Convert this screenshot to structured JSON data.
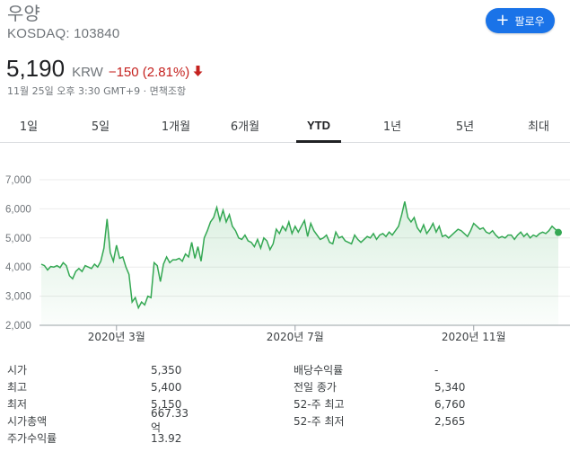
{
  "header": {
    "company": "우양",
    "ticker": "KOSDAQ: 103840",
    "follow_label": "팔로우"
  },
  "quote": {
    "price": "5,190",
    "currency": "KRW",
    "change": "−150 (2.81%)",
    "timestamp": "11월 25일 오후 3:30 GMT+9 · 면책조항"
  },
  "tabs": [
    {
      "label": "1일"
    },
    {
      "label": "5일"
    },
    {
      "label": "1개월"
    },
    {
      "label": "6개월"
    },
    {
      "label": "YTD",
      "active": true
    },
    {
      "label": "1년"
    },
    {
      "label": "5년"
    },
    {
      "label": "최대"
    }
  ],
  "colors": {
    "line": "#34a853",
    "accent": "#1a73e8",
    "negative": "#c5221f"
  },
  "chart_data": {
    "type": "area",
    "ylim": [
      2000,
      7000
    ],
    "yticks": [
      "7,000",
      "6,000",
      "5,000",
      "4,000",
      "3,000",
      "2,000"
    ],
    "ytick_values": [
      7000,
      6000,
      5000,
      4000,
      3000,
      2000
    ],
    "xtick_labels": [
      "2020년 3월",
      "2020년 7월",
      "2020년 11월"
    ],
    "xtick_index": [
      24,
      81,
      138
    ],
    "values": [
      4100,
      4050,
      3900,
      4020,
      4000,
      4050,
      3980,
      4150,
      4050,
      3700,
      3600,
      3850,
      3950,
      3850,
      4050,
      4000,
      3950,
      4100,
      4000,
      4200,
      4650,
      5650,
      4500,
      4200,
      4750,
      4300,
      4350,
      4000,
      3750,
      2800,
      2950,
      2600,
      2800,
      2700,
      3000,
      2950,
      4150,
      4050,
      3500,
      4100,
      4350,
      4150,
      4250,
      4250,
      4300,
      4200,
      4450,
      4350,
      4850,
      4300,
      4700,
      4200,
      5000,
      5250,
      5550,
      5700,
      6050,
      5600,
      5950,
      5550,
      5800,
      5400,
      5250,
      5000,
      4950,
      5100,
      4900,
      4850,
      4700,
      4950,
      4650,
      5000,
      4900,
      4600,
      4800,
      5300,
      5150,
      5400,
      5250,
      5550,
      5150,
      5400,
      5200,
      5400,
      5600,
      5050,
      5500,
      5250,
      5100,
      4950,
      5000,
      5100,
      4850,
      4800,
      5200,
      5000,
      5050,
      4900,
      4850,
      4800,
      5100,
      4950,
      4850,
      4950,
      5050,
      5000,
      5150,
      4950,
      5100,
      5150,
      5050,
      5200,
      5100,
      5250,
      5400,
      5800,
      6250,
      5700,
      5550,
      5700,
      5350,
      5200,
      5450,
      5150,
      5300,
      5500,
      5200,
      5400,
      5050,
      5100,
      5000,
      5100,
      5200,
      5300,
      5250,
      5150,
      5050,
      5250,
      5500,
      5400,
      5300,
      5350,
      5200,
      5150,
      5250,
      5100,
      5000,
      5050,
      5000,
      5100,
      5100,
      4950,
      5100,
      5200,
      5050,
      5150,
      5000,
      5100,
      5050,
      5150,
      5200,
      5150,
      5250,
      5400,
      5300,
      5190
    ]
  },
  "stats": {
    "left": [
      {
        "k": "시가",
        "v": "5,350"
      },
      {
        "k": "최고",
        "v": "5,400"
      },
      {
        "k": "최저",
        "v": "5,150"
      },
      {
        "k": "시가총액",
        "v": "667.33억"
      },
      {
        "k": "주가수익률",
        "v": "13.92"
      }
    ],
    "right": [
      {
        "k": "배당수익률",
        "v": "-"
      },
      {
        "k": "전일 종가",
        "v": "5,340"
      },
      {
        "k": "52-주 최고",
        "v": "6,760"
      },
      {
        "k": "52-주 최저",
        "v": "2,565"
      }
    ]
  }
}
